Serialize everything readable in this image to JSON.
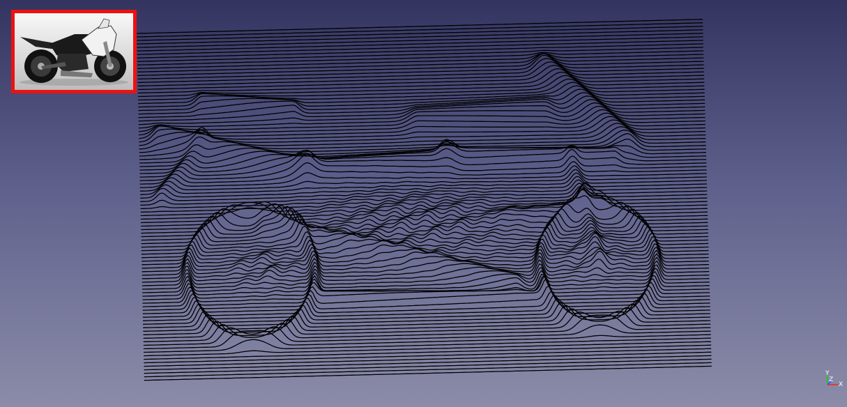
{
  "window": {
    "title": ""
  },
  "scene": {
    "line_color": "#000000",
    "background_top": "#33345f",
    "background_bottom": "#8b8ca8",
    "object": "motorcycle-relief-lines"
  },
  "thumbnail": {
    "icon": "motorcycle-image",
    "border_color": "#ee1111"
  },
  "axis_indicator": {
    "x_label": "X",
    "y_label": "Y",
    "z_label": "Z",
    "x_color": "#e03a3a",
    "y_color": "#2fc02f",
    "z_color": "#3a5aff"
  }
}
